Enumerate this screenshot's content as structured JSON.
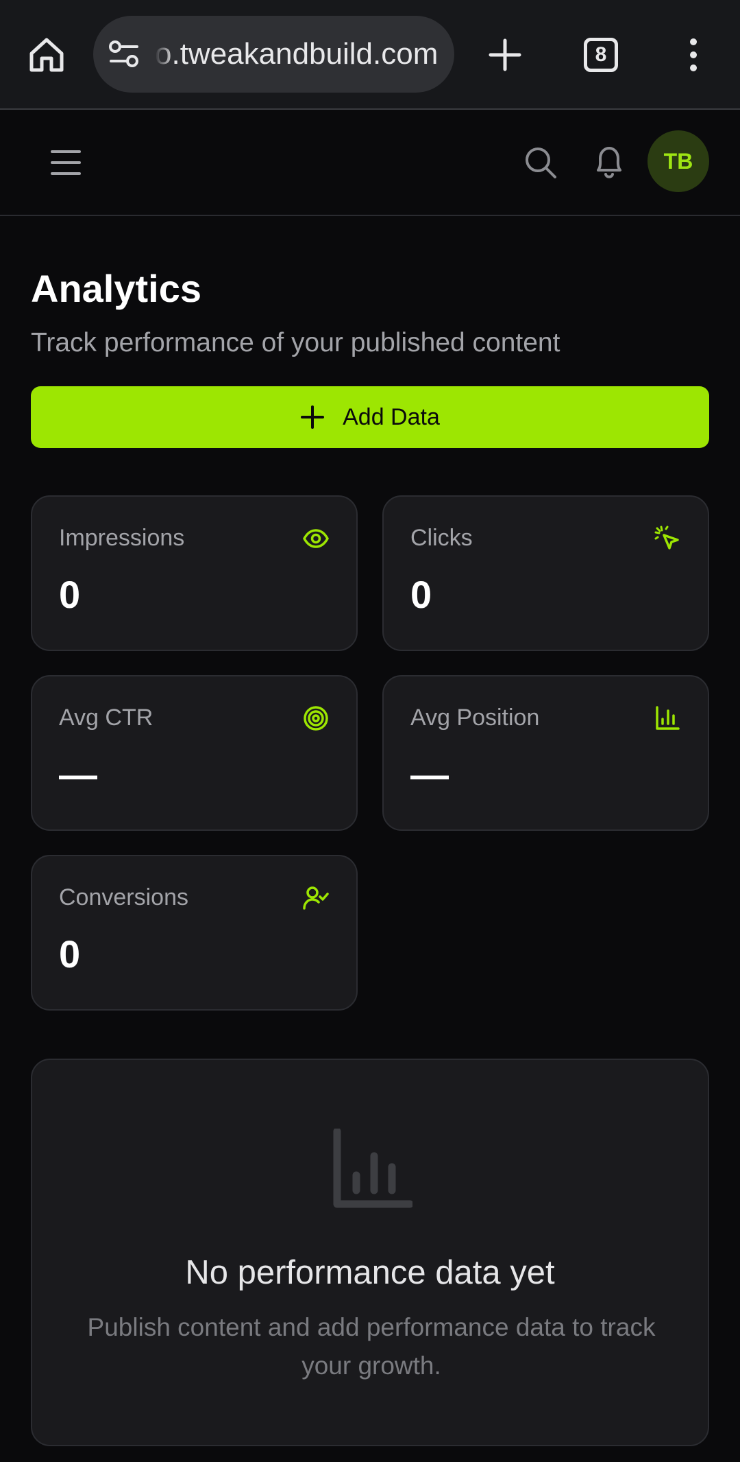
{
  "browser": {
    "url": "o.tweakandbuild.com",
    "tab_count": "8"
  },
  "header": {
    "avatar_initials": "TB"
  },
  "page": {
    "title": "Analytics",
    "subtitle": "Track performance of your published content",
    "add_button_label": "Add Data"
  },
  "stats": [
    {
      "label": "Impressions",
      "value": "0",
      "icon": "eye-icon"
    },
    {
      "label": "Clicks",
      "value": "0",
      "icon": "cursor-click-icon"
    },
    {
      "label": "Avg CTR",
      "value": "—",
      "icon": "target-icon"
    },
    {
      "label": "Avg Position",
      "value": "—",
      "icon": "bar-chart-icon"
    },
    {
      "label": "Conversions",
      "value": "0",
      "icon": "user-check-icon"
    }
  ],
  "empty_state": {
    "title": "No performance data yet",
    "description": "Publish content and add performance data to track your growth."
  },
  "colors": {
    "accent": "#9de602",
    "background": "#0a0a0c",
    "card": "#1a1a1d"
  }
}
